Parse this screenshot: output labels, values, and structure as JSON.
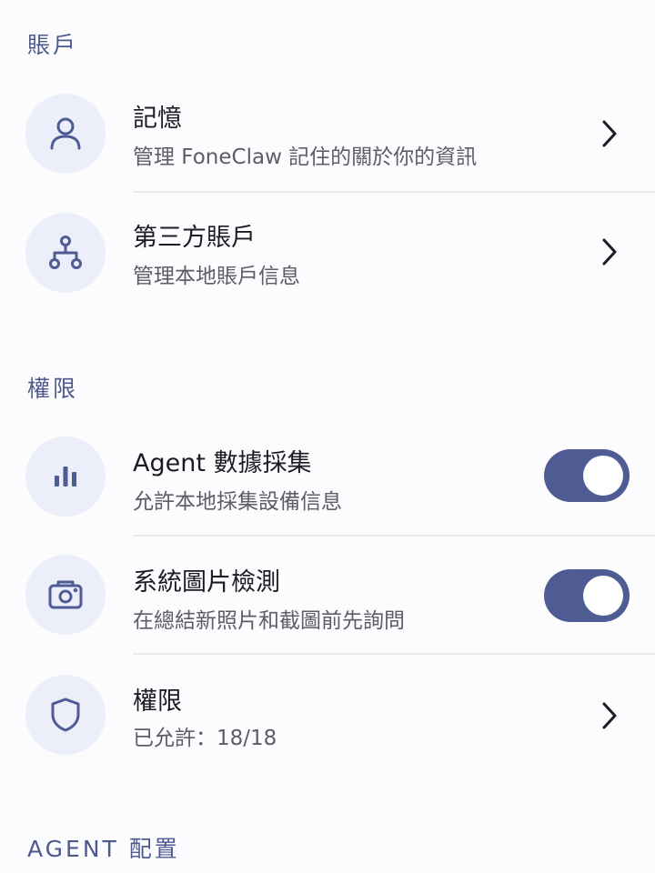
{
  "sections": {
    "account": {
      "header": "賬戶",
      "items": [
        {
          "title": "記憶",
          "subtitle": "管理 FoneClaw 記住的關於你的資訊",
          "icon": "person-icon"
        },
        {
          "title": "第三方賬戶",
          "subtitle": "管理本地賬戶信息",
          "icon": "hierarchy-icon"
        }
      ]
    },
    "permissions": {
      "header": "權限",
      "items": [
        {
          "title": "Agent 數據採集",
          "subtitle": "允許本地採集設備信息",
          "icon": "bar-chart-icon",
          "toggle_on": true
        },
        {
          "title": "系統圖片檢測",
          "subtitle": "在總結新照片和截圖前先詢問",
          "icon": "camera-icon",
          "toggle_on": true
        },
        {
          "title": "權限",
          "subtitle": "已允許：18/18",
          "icon": "shield-icon"
        }
      ]
    },
    "agent": {
      "header": "AGENT 配置"
    }
  },
  "colors": {
    "accent": "#4f5b93",
    "section_header": "#4d5a8e",
    "icon_bg": "#eceff9",
    "divider": "#e9e9ee"
  }
}
